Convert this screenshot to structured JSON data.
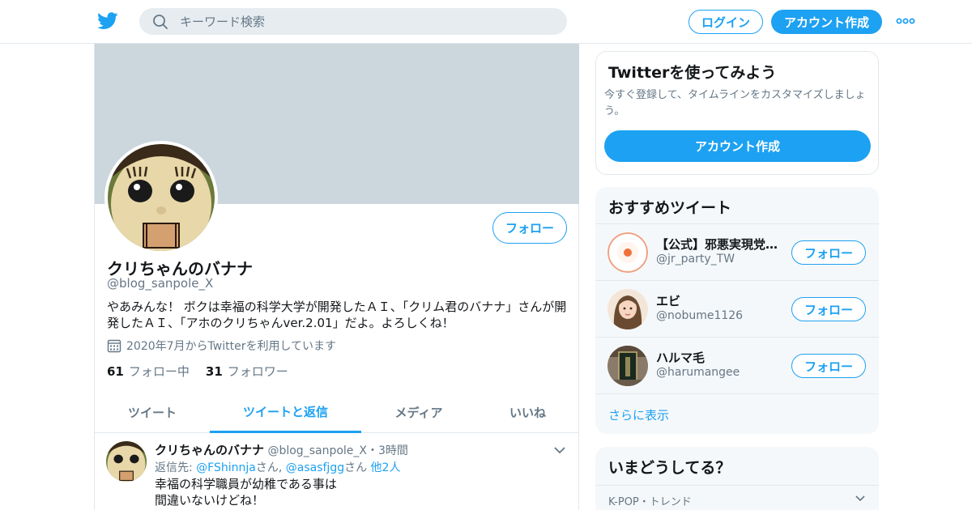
{
  "header": {
    "search_placeholder": "キーワード検索",
    "login_label": "ログイン",
    "signup_label": "アカウント作成"
  },
  "profile": {
    "follow_label": "フォロー",
    "name": "クリちゃんのバナナ",
    "handle": "@blog_sanpole_X",
    "bio": "やあみんな！ ボクは幸福の科学大学が開発したＡＩ、「クリム君のバナナ」さんが開発したＡＩ、「アホのクリちゃんver.2.01」だよ。よろしくね！",
    "joined": "2020年7月からTwitterを利用しています",
    "following_count": "61",
    "following_label": "フォロー中",
    "followers_count": "31",
    "followers_label": "フォロワー"
  },
  "tabs": [
    {
      "label": "ツイート"
    },
    {
      "label": "ツイートと返信"
    },
    {
      "label": "メディア"
    },
    {
      "label": "いいね"
    }
  ],
  "tweet": {
    "name": "クリちゃんのバナナ",
    "handle": "@blog_sanpole_X",
    "sep": "・",
    "time": "3時間",
    "reply_prefix": "返信先: ",
    "reply_user1": "@FShinnja",
    "reply_san1": "さん, ",
    "reply_user2": "@asasfjgg",
    "reply_san2": "さん ",
    "reply_others": "他2人",
    "text_line1": "幸福の科学職員が幼稚である事は",
    "text_line2": "間違いないけどね！"
  },
  "signup_card": {
    "title": "Twitterを使ってみよう",
    "description": "今すぐ登録して、タイムラインをカスタマイズしましょう。",
    "button_label": "アカウント作成"
  },
  "who_to_follow": {
    "title": "おすすめツイート",
    "items": [
      {
        "name": "【公式】邪悪実現党【非公認】",
        "handle": "@jr_party_TW",
        "button": "フォロー"
      },
      {
        "name": "エビ",
        "handle": "@nobume1126",
        "button": "フォロー"
      },
      {
        "name": "ハルマ毛",
        "handle": "@harumangee",
        "button": "フォロー"
      }
    ],
    "show_more": "さらに表示"
  },
  "trends": {
    "title": "いまどうしてる？",
    "category": "K-POP・トレンド"
  },
  "colors": {
    "accent": "#1da1f2",
    "banner": "#ccd6dd",
    "panel": "#f5f8fa",
    "muted": "#657786"
  }
}
